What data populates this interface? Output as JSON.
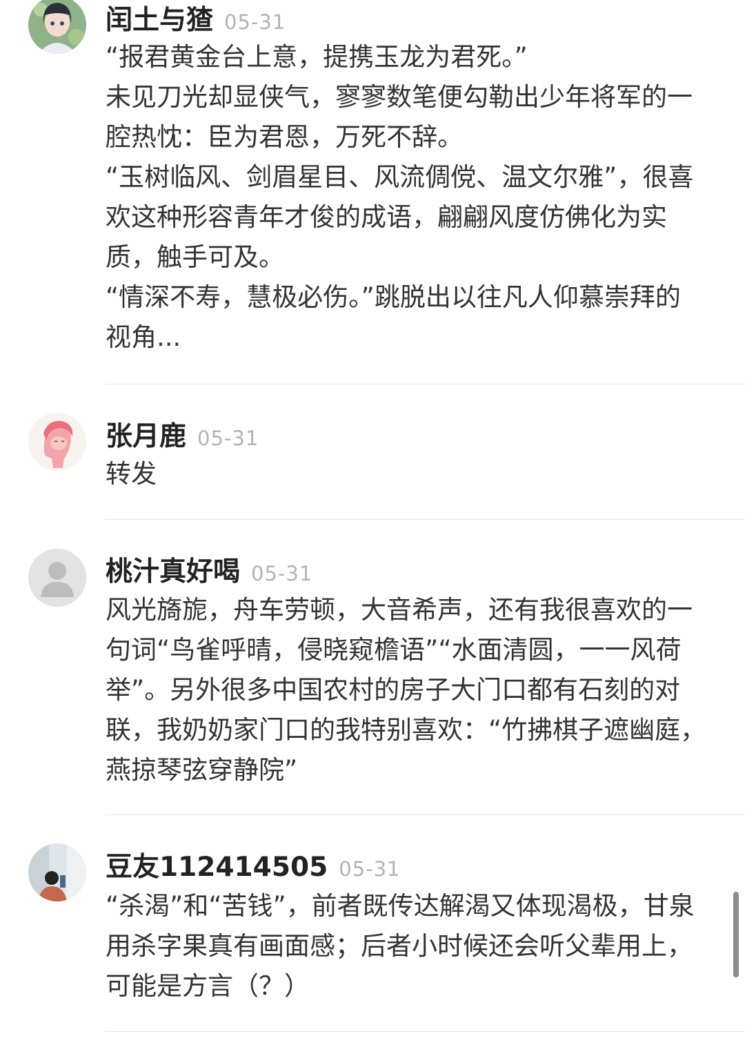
{
  "comments": [
    {
      "username": "闰土与猹",
      "date": "05-31",
      "avatar_icon": "anime-girl-avatar",
      "lines": [
        "“报君黄金台上意，提携玉龙为君死。”",
        "未见刀光却显侠气，寥寥数笔便勾勒出少年将军的一腔热忱：臣为君恩，万死不辞。",
        "“玉树临风、剑眉星目、风流倜傥、温文尔雅”，很喜欢这种形容青年才俊的成语，翩翩风度仿佛化为实质，触手可及。",
        "“情深不寿，慧极必伤。”跳脱出以往凡人仰慕崇拜的视角..."
      ]
    },
    {
      "username": "张月鹿",
      "date": "05-31",
      "avatar_icon": "pink-pony-avatar",
      "lines": [
        "转发"
      ]
    },
    {
      "username": "桃汁真好喝",
      "date": "05-31",
      "avatar_icon": "default-user-avatar",
      "lines": [
        "风光旖旎，舟车劳顿，大音希声，还有我很喜欢的一句词“鸟雀呼晴，侵晓窥檐语”“水面清圆，一一风荷举”。另外很多中国农村的房子大门口都有石刻的对联，我奶奶家门口的我特别喜欢：“竹拂棋子遮幽庭，燕掠琴弦穿静院”"
      ]
    },
    {
      "username": "豆友112414505",
      "date": "05-31",
      "avatar_icon": "photo-person-avatar",
      "lines": [
        "“杀渴”和“苦钱”，前者既传达解渴又体现渴极，甘泉用杀字果真有画面感；后者小时候还会听父辈用上，可能是方言（？）"
      ]
    }
  ],
  "colors": {
    "username": "#222222",
    "date": "#b3b3b3",
    "body_text": "#333333",
    "divider": "#e5e5e5",
    "scrollbar": "#8c8c8c"
  }
}
